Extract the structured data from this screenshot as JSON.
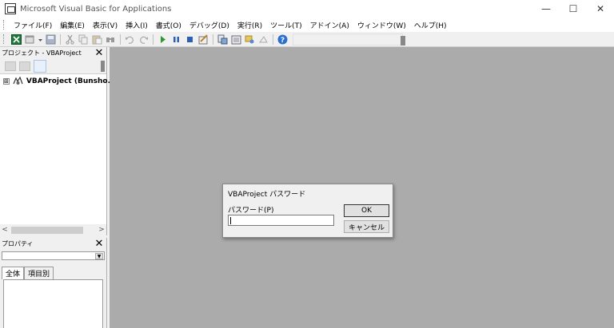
{
  "window": {
    "title": "Microsoft Visual Basic for Applications",
    "minimize": "—",
    "maximize": "☐",
    "close": "✕"
  },
  "menu": [
    "ファイル(F)",
    "編集(E)",
    "表示(V)",
    "挿入(I)",
    "書式(O)",
    "デバッグ(D)",
    "実行(R)",
    "ツール(T)",
    "アドイン(A)",
    "ウィンドウ(W)",
    "ヘルプ(H)"
  ],
  "project_panel": {
    "title": "プロジェクト - VBAProject",
    "close": "✕",
    "tree_item": "VBAProject (Bunsho.xl",
    "expander": "⊞",
    "scroll_left": "<",
    "scroll_right": ">"
  },
  "properties_panel": {
    "title": "プロパティ",
    "close": "✕",
    "tabs": [
      "全体",
      "項目別"
    ]
  },
  "dialog": {
    "title": "VBAProject パスワード",
    "label": "パスワード(P)",
    "value": "",
    "ok": "OK",
    "cancel": "キャンセル"
  },
  "colors": {
    "mdi_background": "#ababab",
    "chrome": "#f0f0f0",
    "titlebar": "#ffffff"
  }
}
